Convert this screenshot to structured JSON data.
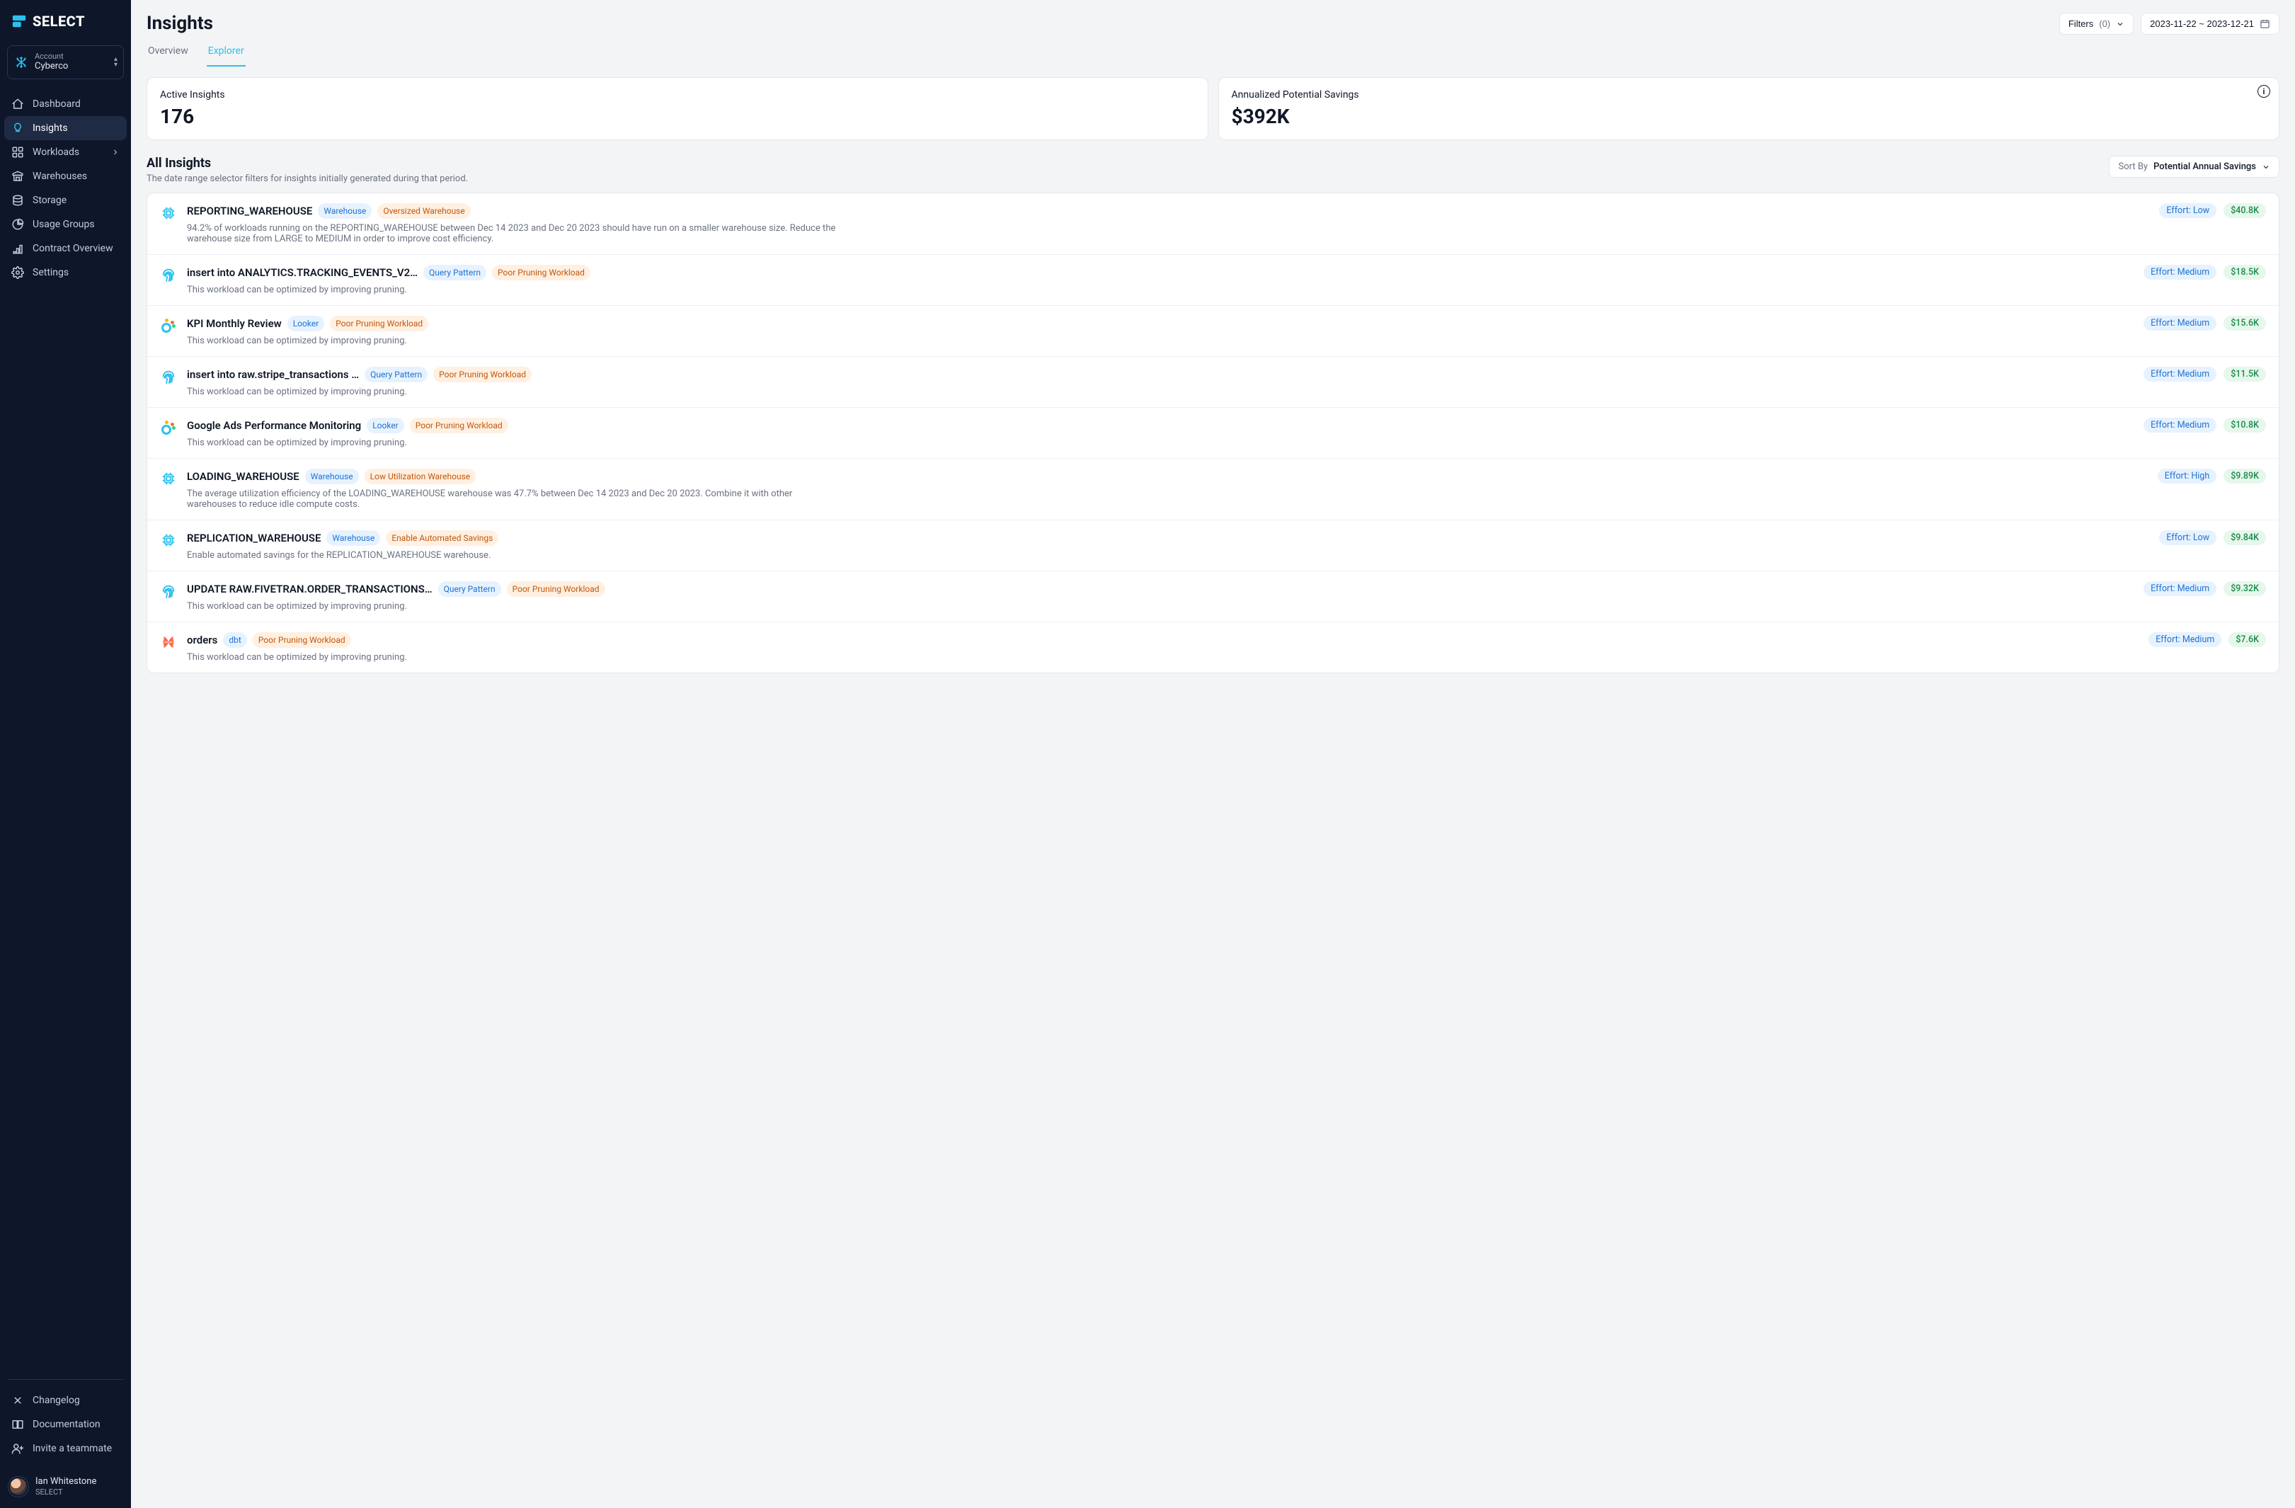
{
  "brand": {
    "name": "SELECT"
  },
  "account": {
    "label": "Account",
    "org": "Cyberco"
  },
  "nav": [
    {
      "key": "dashboard",
      "label": "Dashboard",
      "icon": "home"
    },
    {
      "key": "insights",
      "label": "Insights",
      "icon": "bulb",
      "active": true
    },
    {
      "key": "workloads",
      "label": "Workloads",
      "icon": "workloads",
      "chevron": true
    },
    {
      "key": "warehouses",
      "label": "Warehouses",
      "icon": "warehouse"
    },
    {
      "key": "storage",
      "label": "Storage",
      "icon": "storage"
    },
    {
      "key": "usageGroups",
      "label": "Usage Groups",
      "icon": "usage"
    },
    {
      "key": "contract",
      "label": "Contract Overview",
      "icon": "contract"
    },
    {
      "key": "settings",
      "label": "Settings",
      "icon": "settings"
    }
  ],
  "footerNav": [
    {
      "key": "changelog",
      "label": "Changelog",
      "icon": "changelog"
    },
    {
      "key": "documentation",
      "label": "Documentation",
      "icon": "book"
    },
    {
      "key": "invite",
      "label": "Invite a teammate",
      "icon": "invite"
    }
  ],
  "user": {
    "name": "Ian Whitestone",
    "company": "SELECT"
  },
  "page": {
    "title": "Insights"
  },
  "tabs": [
    {
      "key": "overview",
      "label": "Overview"
    },
    {
      "key": "explorer",
      "label": "Explorer",
      "active": true
    }
  ],
  "filters": {
    "label": "Filters",
    "count": "(0)"
  },
  "dateRange": {
    "text": "2023-11-22 ~ 2023-12-21"
  },
  "stats": {
    "activeInsights": {
      "label": "Active Insights",
      "value": "176"
    },
    "annualSavings": {
      "label": "Annualized Potential Savings",
      "value": "$392K"
    }
  },
  "listHeader": {
    "title": "All Insights",
    "subtitle": "The date range selector filters for insights initially generated during that period.",
    "sortByLabel": "Sort By",
    "sortByValue": "Potential Annual Savings"
  },
  "tagColors": {
    "Warehouse": "blue",
    "Query Pattern": "blue",
    "Looker": "blue",
    "dbt": "blue",
    "Oversized Warehouse": "orange",
    "Poor Pruning Workload": "orange",
    "Low Utilization Warehouse": "orange",
    "Enable Automated Savings": "orange"
  },
  "insights": [
    {
      "icon": "cpu",
      "title": "REPORTING_WAREHOUSE",
      "tags": [
        "Warehouse",
        "Oversized Warehouse"
      ],
      "desc": "94.2% of workloads running on the REPORTING_WAREHOUSE between Dec 14 2023 and Dec 20 2023 should have run on a smaller warehouse size. Reduce the warehouse size from LARGE to MEDIUM in order to improve cost efficiency.",
      "effort": "Effort: Low",
      "savings": "$40.8K"
    },
    {
      "icon": "fingerprint",
      "title": "insert into ANALYTICS.TRACKING_EVENTS_V2…",
      "tags": [
        "Query Pattern",
        "Poor Pruning Workload"
      ],
      "desc": "This workload can be optimized by improving pruning.",
      "effort": "Effort: Medium",
      "savings": "$18.5K"
    },
    {
      "icon": "looker",
      "title": "KPI Monthly Review",
      "tags": [
        "Looker",
        "Poor Pruning Workload"
      ],
      "desc": "This workload can be optimized by improving pruning.",
      "effort": "Effort: Medium",
      "savings": "$15.6K"
    },
    {
      "icon": "fingerprint",
      "title": "insert into raw.stripe_transactions …",
      "tags": [
        "Query Pattern",
        "Poor Pruning Workload"
      ],
      "desc": "This workload can be optimized by improving pruning.",
      "effort": "Effort: Medium",
      "savings": "$11.5K"
    },
    {
      "icon": "looker",
      "title": "Google Ads Performance Monitoring",
      "tags": [
        "Looker",
        "Poor Pruning Workload"
      ],
      "desc": "This workload can be optimized by improving pruning.",
      "effort": "Effort: Medium",
      "savings": "$10.8K"
    },
    {
      "icon": "cpu",
      "title": "LOADING_WAREHOUSE",
      "tags": [
        "Warehouse",
        "Low Utilization Warehouse"
      ],
      "desc": "The average utilization efficiency of the LOADING_WAREHOUSE warehouse was 47.7% between Dec 14 2023 and Dec 20 2023. Combine it with other warehouses to reduce idle compute costs.",
      "effort": "Effort: High",
      "savings": "$9.89K"
    },
    {
      "icon": "cpu",
      "title": "REPLICATION_WAREHOUSE",
      "tags": [
        "Warehouse",
        "Enable Automated Savings"
      ],
      "desc": "Enable automated savings for the REPLICATION_WAREHOUSE warehouse.",
      "effort": "Effort: Low",
      "savings": "$9.84K"
    },
    {
      "icon": "fingerprint",
      "title": "UPDATE RAW.FIVETRAN.ORDER_TRANSACTIONS…",
      "tags": [
        "Query Pattern",
        "Poor Pruning Workload"
      ],
      "desc": "This workload can be optimized by improving pruning.",
      "effort": "Effort: Medium",
      "savings": "$9.32K"
    },
    {
      "icon": "dbt",
      "title": "orders",
      "tags": [
        "dbt",
        "Poor Pruning Workload"
      ],
      "desc": "This workload can be optimized by improving pruning.",
      "effort": "Effort: Medium",
      "savings": "$7.6K"
    }
  ]
}
